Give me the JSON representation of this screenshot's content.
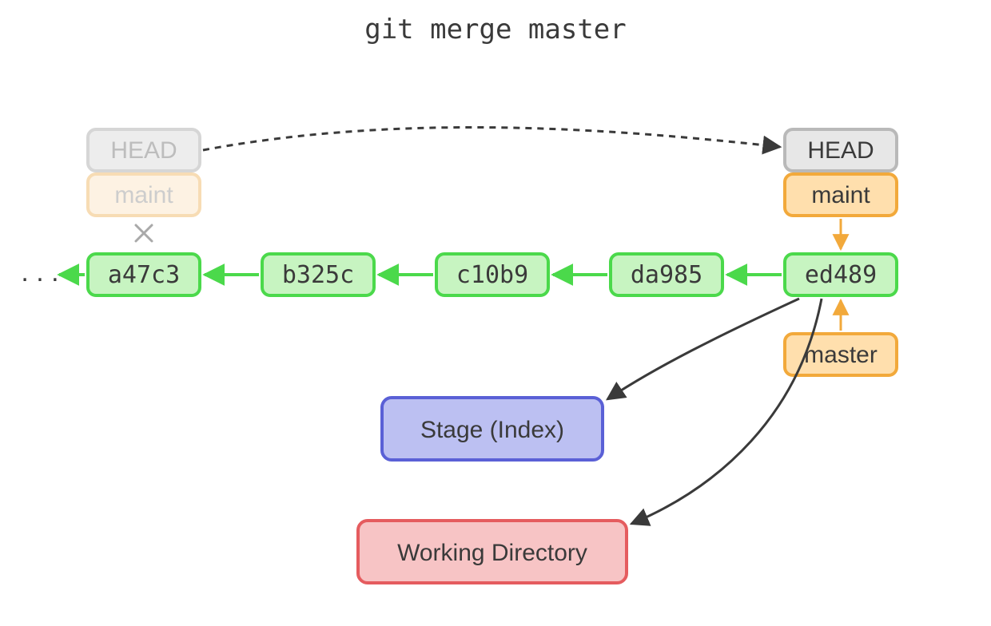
{
  "title": "git merge master",
  "ellipsis": ". . .",
  "commits": [
    "a47c3",
    "b325c",
    "c10b9",
    "da985",
    "ed489"
  ],
  "head_old": "HEAD",
  "branch_old": "maint",
  "head_new": "HEAD",
  "branch_new": "maint",
  "branch_master": "master",
  "stage_label": "Stage (Index)",
  "workdir_label": "Working Directory",
  "colors": {
    "commit_fill": "#c7f4c1",
    "commit_stroke": "#4bd94b",
    "commit_text": "#3a3a3a",
    "arrow_green": "#4bd94b",
    "faded_grey_fill": "#ededed",
    "faded_grey_stroke": "#d6d6d6",
    "faded_grey_text": "#bdbdbd",
    "faded_orange_fill": "#fdf2e3",
    "faded_orange_stroke": "#f7dcb4",
    "faded_orange_text": "#cdcdcd",
    "grey_fill": "#e7e7e7",
    "grey_stroke": "#b9b9b9",
    "grey_text": "#3a3a3a",
    "orange_fill": "#ffdfad",
    "orange_stroke": "#f2a93b",
    "orange_text": "#3a3a3a",
    "arrow_orange": "#f2a93b",
    "stage_fill": "#bcc0f2",
    "stage_stroke": "#5a60d6",
    "workdir_fill": "#f7c4c5",
    "workdir_stroke": "#e55c5f",
    "dark_arrow": "#3a3a3a"
  }
}
